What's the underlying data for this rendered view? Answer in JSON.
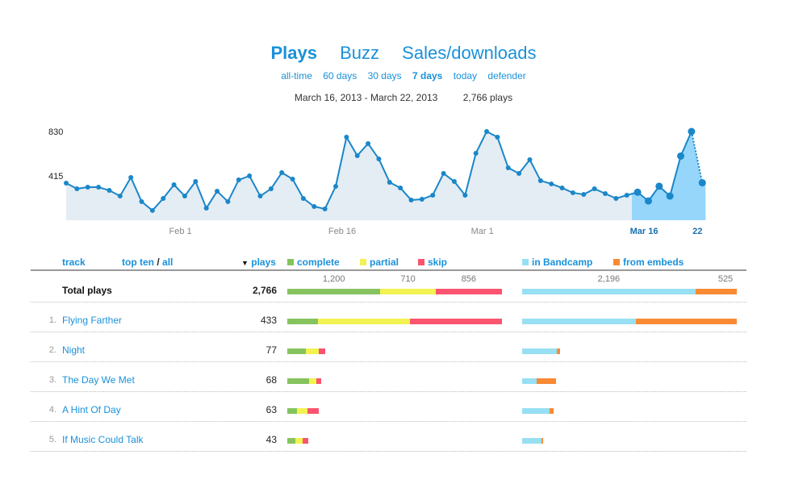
{
  "nav": {
    "tabs": [
      {
        "label": "Plays",
        "active": true
      },
      {
        "label": "Buzz",
        "active": false
      },
      {
        "label": "Sales/downloads",
        "active": false
      }
    ],
    "ranges": [
      {
        "label": "all-time",
        "active": false
      },
      {
        "label": "60 days",
        "active": false
      },
      {
        "label": "30 days",
        "active": false
      },
      {
        "label": "7 days",
        "active": true
      },
      {
        "label": "today",
        "active": false
      },
      {
        "label": "defender",
        "active": false
      }
    ]
  },
  "summary": {
    "date_range": "March 16, 2013 - March 22, 2013",
    "total": "2,766 plays"
  },
  "colors": {
    "accent": "#1a91da",
    "line": "#1a87c9",
    "area": "#e4ecf4",
    "highlight": "#96d6fb",
    "complete": "#86c35f",
    "partial": "#f2f252",
    "skip": "#fb5470",
    "bandcamp": "#97dff2",
    "embeds": "#f98a34"
  },
  "chart_data": {
    "type": "area",
    "title": "Plays",
    "xlabel": "",
    "ylabel": "",
    "ylim": [
      0,
      830
    ],
    "yticks": [
      "830",
      "415"
    ],
    "ytick_values": [
      830,
      415
    ],
    "xticks": [
      {
        "label": "Feb 1",
        "index": 10,
        "highlight": false
      },
      {
        "label": "Feb 16",
        "index": 25,
        "highlight": false
      },
      {
        "label": "Mar 1",
        "index": 38,
        "highlight": false
      },
      {
        "label": "Mar 16",
        "index": 53,
        "highlight": true
      },
      {
        "label": "22",
        "index": 59,
        "highlight": true
      }
    ],
    "highlight_range": [
      53,
      59
    ],
    "partial_last_point": true,
    "grid": false,
    "values": [
      347,
      294,
      309,
      309,
      279,
      226,
      400,
      174,
      91,
      204,
      332,
      226,
      362,
      113,
      272,
      174,
      377,
      415,
      226,
      294,
      445,
      385,
      204,
      128,
      106,
      317,
      777,
      604,
      717,
      573,
      355,
      302,
      189,
      196,
      234,
      438,
      362,
      234,
      626,
      830,
      777,
      490,
      438,
      566,
      370,
      340,
      302,
      257,
      241,
      294,
      249,
      204,
      234,
      262,
      180,
      318,
      226,
      600,
      830,
      350
    ]
  },
  "table": {
    "headers": {
      "track": "track",
      "top_ten": "top ten",
      "slash": "/",
      "all": "all",
      "sort_arrow": "▼",
      "plays": "plays",
      "complete": "complete",
      "partial": "partial",
      "skip": "skip",
      "bandcamp": "in Bandcamp",
      "embeds": "from embeds"
    },
    "total": {
      "label": "Total plays",
      "plays": "2,766",
      "complete": 1200,
      "partial": 710,
      "skip": 856,
      "complete_label": "1,200",
      "partial_label": "710",
      "skip_label": "856",
      "bandcamp": 2196,
      "embeds": 525,
      "bandcamp_label": "2,196",
      "embeds_label": "525"
    },
    "rows": [
      {
        "rank": "1.",
        "name": "Flying Farther",
        "plays": "433",
        "complete": 62,
        "partial": 186,
        "skip": 185,
        "bandcamp": 230,
        "embeds": 203
      },
      {
        "rank": "2.",
        "name": "Night",
        "plays": "77",
        "complete": 37,
        "partial": 27,
        "skip": 13,
        "bandcamp": 70,
        "embeds": 7
      },
      {
        "rank": "3.",
        "name": "The Day We Met",
        "plays": "68",
        "complete": 44,
        "partial": 14,
        "skip": 10,
        "bandcamp": 30,
        "embeds": 38
      },
      {
        "rank": "4.",
        "name": "A Hint Of Day",
        "plays": "63",
        "complete": 20,
        "partial": 20,
        "skip": 23,
        "bandcamp": 56,
        "embeds": 7
      },
      {
        "rank": "5.",
        "name": "If Music Could Talk",
        "plays": "43",
        "complete": 17,
        "partial": 14,
        "skip": 12,
        "bandcamp": 39,
        "embeds": 4
      }
    ]
  }
}
